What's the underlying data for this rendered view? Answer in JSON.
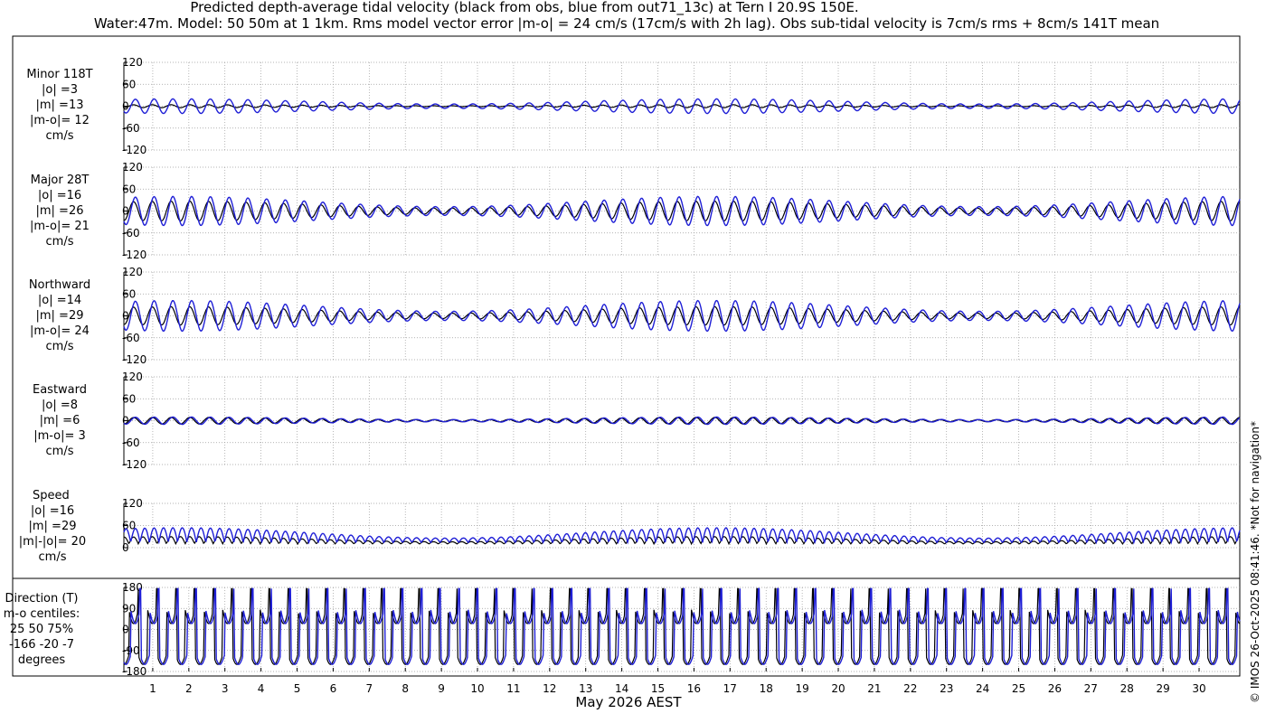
{
  "title_line1": "Predicted depth-average tidal velocity (black from obs, blue from out71_13c) at Tern I 20.9S 150E.",
  "title_line2": "Water:47m. Model: 50 50m at 1 1km. Rms model vector error |m-o| = 24 cm/s (17cm/s with 2h lag). Obs sub-tidal velocity is 7cm/s rms + 8cm/s 141T mean",
  "xlabel": "May 2026 AEST",
  "credit": "© IMOS 26-Oct-2025 08:41:46. *Not for navigation*",
  "colors": {
    "obs": "#000000",
    "model": "#1f1fd6",
    "grid": "#9a9a9a"
  },
  "chart_data": [
    {
      "type": "line",
      "panel": "minor",
      "labels": [
        "Minor 118T",
        "|o| =3",
        "|m| =13",
        "|m-o|= 12",
        "cm/s"
      ],
      "ylim": [
        -120,
        120
      ],
      "yticks": [
        "120",
        "60",
        "0",
        "-60",
        "-120"
      ],
      "series": [
        {
          "name": "obs",
          "amplitude": 4,
          "mean": 0
        },
        {
          "name": "model",
          "amplitude": 20,
          "mean": 0
        }
      ]
    },
    {
      "type": "line",
      "panel": "major",
      "labels": [
        "Major 28T",
        "|o| =16",
        "|m| =26",
        "|m-o|= 21",
        "cm/s"
      ],
      "ylim": [
        -120,
        120
      ],
      "yticks": [
        "120",
        "60",
        "0",
        "-60",
        "-120"
      ],
      "series": [
        {
          "name": "obs",
          "amplitude": 27,
          "mean": 0
        },
        {
          "name": "model",
          "amplitude": 40,
          "mean": 0
        }
      ]
    },
    {
      "type": "line",
      "panel": "north",
      "labels": [
        "Northward",
        "|o| =14",
        "|m| =29",
        "|m-o|= 24",
        "cm/s"
      ],
      "ylim": [
        -120,
        120
      ],
      "yticks": [
        "120",
        "60",
        "0",
        "-60",
        "-120"
      ],
      "series": [
        {
          "name": "obs",
          "amplitude": 25,
          "mean": 0
        },
        {
          "name": "model",
          "amplitude": 42,
          "mean": 0
        }
      ]
    },
    {
      "type": "line",
      "panel": "east",
      "labels": [
        "Eastward",
        "|o| =8",
        "|m| =6",
        "|m-o|= 3",
        "cm/s"
      ],
      "ylim": [
        -120,
        120
      ],
      "yticks": [
        "120",
        "60",
        "0",
        "-60",
        "-120"
      ],
      "series": [
        {
          "name": "obs",
          "amplitude": 9,
          "mean": 0
        },
        {
          "name": "model",
          "amplitude": 10,
          "mean": 0
        }
      ]
    },
    {
      "type": "line",
      "panel": "speed",
      "labels": [
        "Speed",
        "|o| =16",
        "|m| =29",
        "|m|-|o|= 20",
        "cm/s"
      ],
      "ylim": [
        0,
        120
      ],
      "yticks": [
        "120",
        "60",
        "0"
      ],
      "series": [
        {
          "name": "obs",
          "amplitude": 20,
          "mean": 10
        },
        {
          "name": "model",
          "amplitude": 40,
          "mean": 14
        }
      ]
    },
    {
      "type": "line",
      "panel": "direction",
      "labels": [
        "Direction (T)",
        "m-o centiles:",
        "25  50  75%",
        "-166  -20   -7",
        "degrees"
      ],
      "ylim": [
        -180,
        180
      ],
      "yticks": [
        "180",
        "90",
        "0",
        "-90",
        "-180"
      ],
      "series": [
        {
          "name": "obs",
          "mean": 0
        },
        {
          "name": "model",
          "mean": 0
        }
      ]
    }
  ],
  "x_axis": {
    "days": [
      "1",
      "2",
      "3",
      "4",
      "5",
      "6",
      "7",
      "8",
      "9",
      "10",
      "11",
      "12",
      "13",
      "14",
      "15",
      "16",
      "17",
      "18",
      "19",
      "20",
      "21",
      "22",
      "23",
      "24",
      "25",
      "26",
      "27",
      "28",
      "29",
      "30"
    ],
    "xlim_days": [
      0.2,
      31.0
    ]
  }
}
